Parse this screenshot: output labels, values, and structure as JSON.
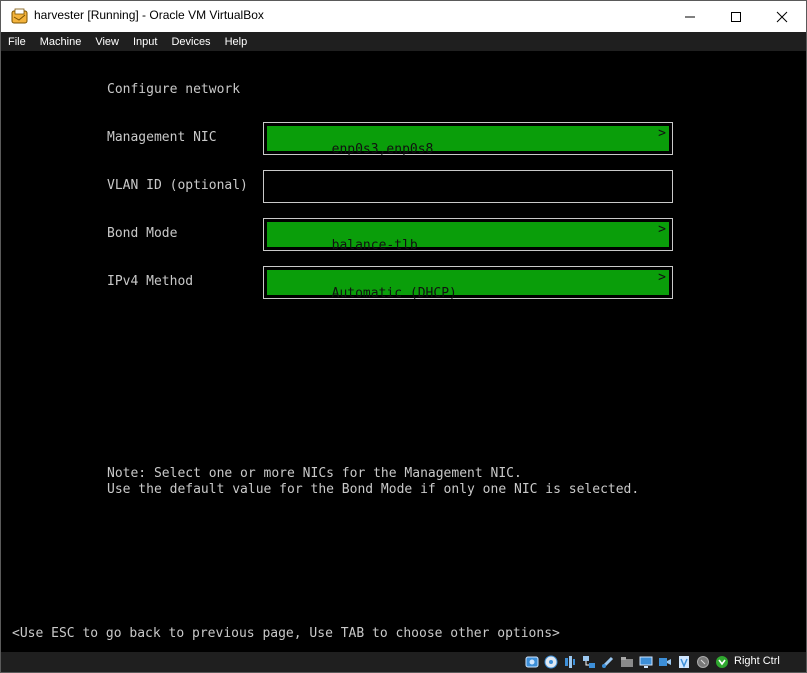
{
  "window": {
    "title": "harvester [Running] - Oracle VM VirtualBox",
    "controls": {
      "minimize": "—",
      "maximize": "☐",
      "close": "✕"
    }
  },
  "menu": [
    "File",
    "Machine",
    "View",
    "Input",
    "Devices",
    "Help"
  ],
  "console": {
    "heading": "Configure network",
    "fields": [
      {
        "label": "Management NIC",
        "value": "enp0s3,enp0s8",
        "arrow": ">"
      },
      {
        "label": "VLAN ID (optional)",
        "value": ""
      },
      {
        "label": "Bond Mode",
        "value": "balance-tlb",
        "arrow": ">"
      },
      {
        "label": "IPv4 Method",
        "value": "Automatic (DHCP)",
        "arrow": ">"
      }
    ],
    "note_line1": "Note: Select one or more NICs for the Management NIC.",
    "note_line2": "Use the default value for the Bond Mode if only one NIC is selected.",
    "hint": "<Use ESC to go back to previous page, Use TAB to choose other options>"
  },
  "statusbar": {
    "host_key": "Right Ctrl",
    "icons": [
      "hard-disk-icon",
      "optical-drive-icon",
      "audio-icon",
      "network-icon",
      "usb-icon",
      "shared-folders-icon",
      "display-icon",
      "recording-icon",
      "cpu-icon",
      "mouse-integration-icon",
      "host-key-arrow-icon"
    ]
  },
  "colors": {
    "field_green": "#0a9e0a",
    "console_text": "#c9c9c9",
    "menubar": "#1f1f1f"
  }
}
